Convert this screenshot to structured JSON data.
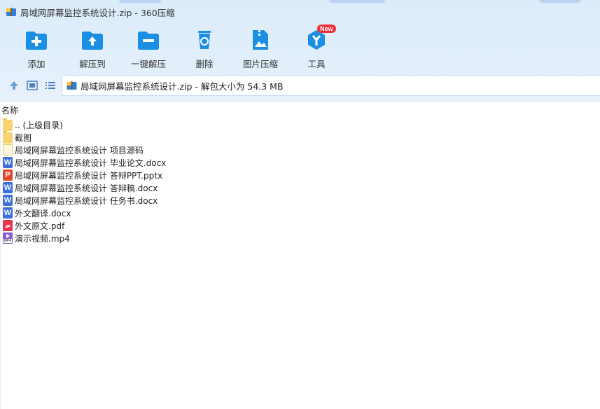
{
  "window": {
    "title": "局域网屏幕监控系统设计.zip - 360压缩"
  },
  "toolbar": {
    "items": [
      {
        "label": "添加",
        "icon": "add-folder-icon"
      },
      {
        "label": "解压到",
        "icon": "extract-to-icon"
      },
      {
        "label": "一键解压",
        "icon": "one-click-extract-icon"
      },
      {
        "label": "删除",
        "icon": "recycle-bin-icon"
      },
      {
        "label": "图片压缩",
        "icon": "image-compress-icon"
      },
      {
        "label": "工具",
        "icon": "tools-icon",
        "badge": "New"
      }
    ],
    "accent": "#1a8fe3"
  },
  "nav": {
    "path": "局域网屏幕监控系统设计.zip - 解包大小为 54.3 MB"
  },
  "columns": {
    "name": "名称"
  },
  "files": [
    {
      "name": ".. (上级目录)",
      "type": "folder"
    },
    {
      "name": "截图",
      "type": "folder"
    },
    {
      "name": "局域网屏幕监控系统设计 项目源码",
      "type": "file"
    },
    {
      "name": "局域网屏幕监控系统设计 毕业论文.docx",
      "type": "word"
    },
    {
      "name": "局域网屏幕监控系统设计 答辩PPT.pptx",
      "type": "ppt"
    },
    {
      "name": "局域网屏幕监控系统设计 答辩稿.docx",
      "type": "word"
    },
    {
      "name": "局域网屏幕监控系统设计 任务书.docx",
      "type": "word"
    },
    {
      "name": "外文翻译.docx",
      "type": "word"
    },
    {
      "name": "外文原文.pdf",
      "type": "pdf"
    },
    {
      "name": "演示视频.mp4",
      "type": "mp4"
    }
  ]
}
